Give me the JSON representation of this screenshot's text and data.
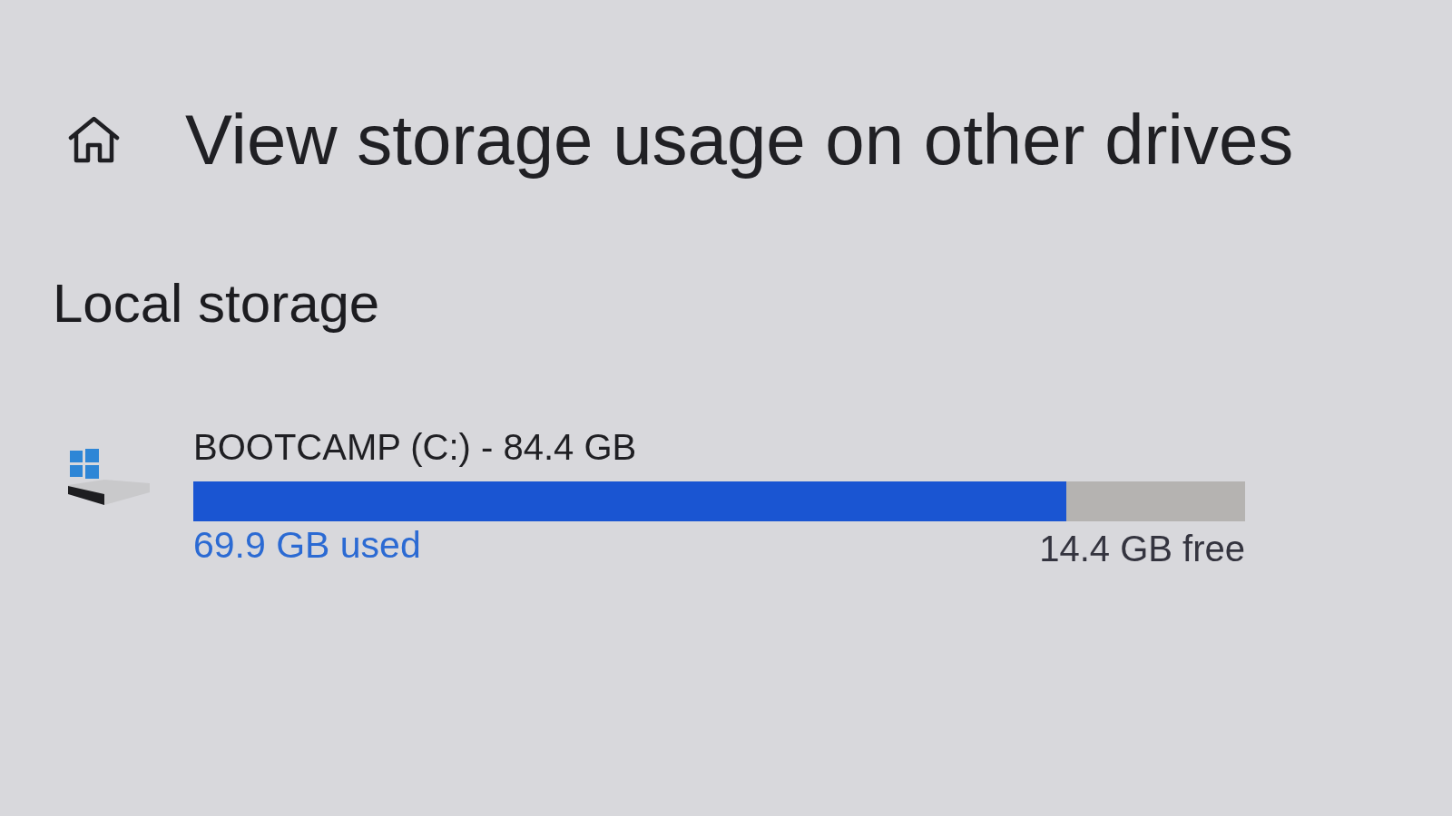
{
  "page": {
    "title": "View storage usage on other drives"
  },
  "section": {
    "heading": "Local storage"
  },
  "drives": [
    {
      "name": "BOOTCAMP (C:) - 84.4 GB",
      "level": 0.83,
      "used": "69.9 GB used",
      "free": "14.4 GB free"
    }
  ]
}
